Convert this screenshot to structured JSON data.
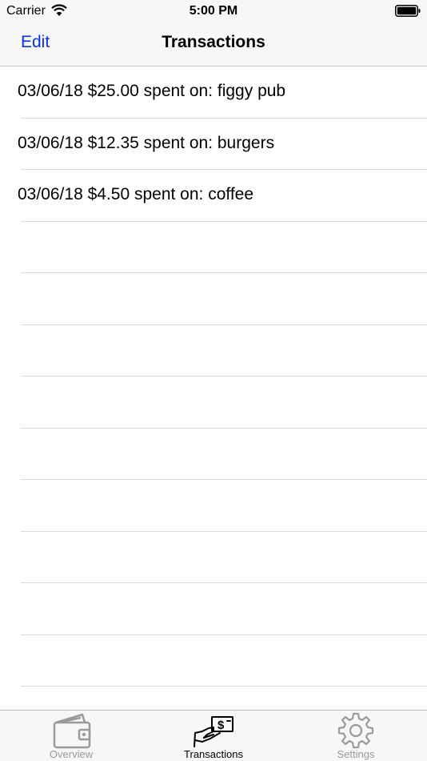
{
  "status_bar": {
    "carrier": "Carrier",
    "time": "5:00 PM",
    "wifi_icon": "wifi-icon",
    "battery_icon": "battery-icon"
  },
  "nav": {
    "edit_label": "Edit",
    "title": "Transactions"
  },
  "transactions": [
    "03/06/18 $25.00 spent on: figgy pub",
    "03/06/18 $12.35 spent on: burgers",
    "03/06/18 $4.50 spent on: coffee"
  ],
  "tab_bar": {
    "tabs": [
      {
        "label": "Overview",
        "icon": "wallet-icon",
        "selected": false
      },
      {
        "label": "Transactions",
        "icon": "hand-money-icon",
        "selected": true
      },
      {
        "label": "Settings",
        "icon": "gear-icon",
        "selected": false
      }
    ]
  },
  "colors": {
    "accent": "#0a2ff2",
    "bar_background": "#f7f7f7",
    "separator": "#d9d9de",
    "inactive_tab": "#9a9a9a"
  }
}
